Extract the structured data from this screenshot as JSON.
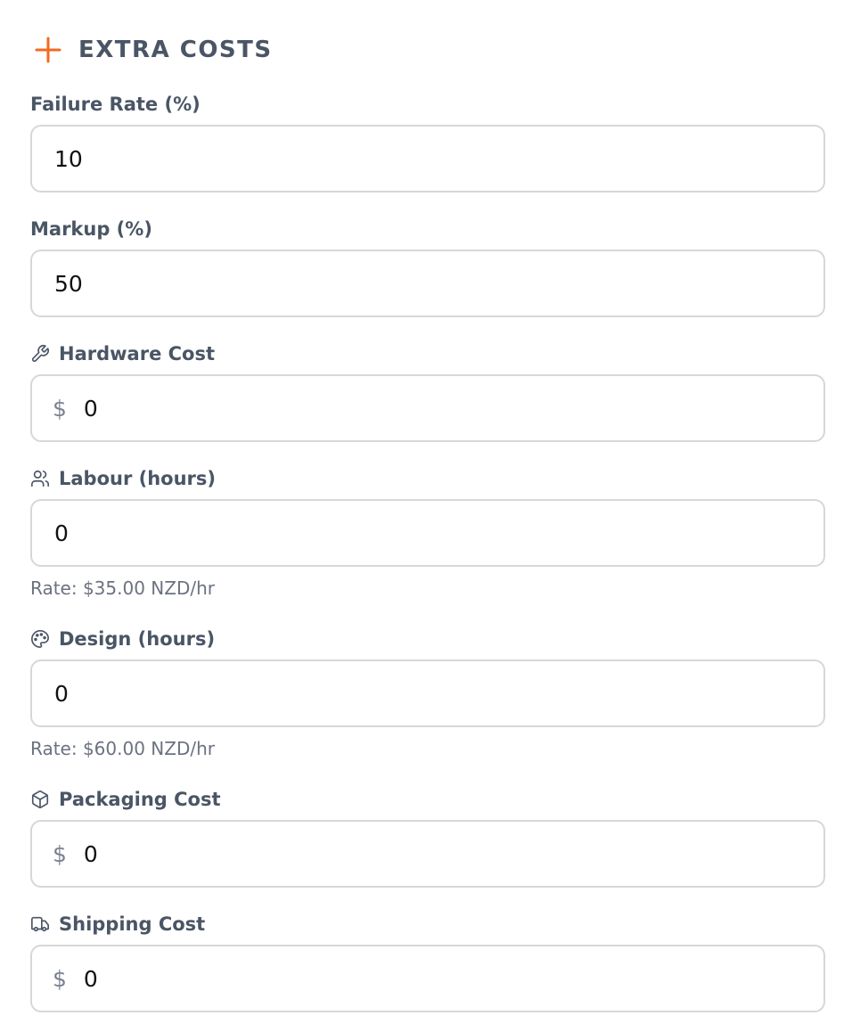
{
  "section": {
    "title": "EXTRA COSTS",
    "icon": "plus-icon",
    "accent_color": "#f26a21"
  },
  "fields": {
    "failure_rate": {
      "label": "Failure Rate (%)",
      "value": "10"
    },
    "markup": {
      "label": "Markup (%)",
      "value": "50"
    },
    "hardware_cost": {
      "label": "Hardware Cost",
      "icon": "wrench-icon",
      "currency": "$",
      "value": "0"
    },
    "labour_hours": {
      "label": "Labour (hours)",
      "icon": "users-icon",
      "value": "0",
      "hint": "Rate: $35.00 NZD/hr"
    },
    "design_hours": {
      "label": "Design (hours)",
      "icon": "palette-icon",
      "value": "0",
      "hint": "Rate: $60.00 NZD/hr"
    },
    "packaging_cost": {
      "label": "Packaging Cost",
      "icon": "box-icon",
      "currency": "$",
      "value": "0"
    },
    "shipping_cost": {
      "label": "Shipping Cost",
      "icon": "truck-icon",
      "currency": "$",
      "value": "0"
    }
  },
  "colors": {
    "label": "#4a5565",
    "border": "#d5d7db",
    "hint": "#6b7280"
  }
}
